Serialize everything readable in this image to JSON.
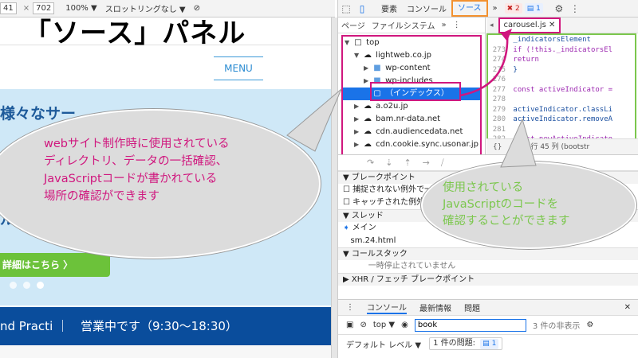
{
  "left": {
    "toolbar": {
      "width_value": "41",
      "height_value": "702",
      "zoom": "100%",
      "zoom_caret": "▼",
      "throttle": "スロットリングなし",
      "throttle_caret": "▼"
    },
    "title": "「ソース」パネル",
    "menu_label": "MENU",
    "hero_heading": "様々なサー",
    "hero_sub": "ルタン",
    "detail_button": "詳細はこちら 〉",
    "footer_text": "nd Practi ｜　営業中です（9:30〜18:30）"
  },
  "devtools": {
    "tabs": [
      "要素",
      "コンソール",
      "ソース"
    ],
    "active_tab": "ソース",
    "more_tabs": "»",
    "error_count": "2",
    "message_count": "1",
    "nav_tabs": [
      "ページ",
      "ファイルシステム"
    ],
    "tree": [
      {
        "label": "top",
        "indent": 0,
        "arrow": "▼",
        "icon": "□",
        "kind": "frame"
      },
      {
        "label": "lightweb.co.jp",
        "indent": 1,
        "arrow": "▼",
        "icon": "☁",
        "kind": "domain"
      },
      {
        "label": "wp-content",
        "indent": 2,
        "arrow": "▶",
        "icon": "■",
        "kind": "folder"
      },
      {
        "label": "wp-includes",
        "indent": 2,
        "arrow": "▶",
        "icon": "■",
        "kind": "folder"
      },
      {
        "label": "（インデックス）",
        "indent": 2,
        "arrow": "",
        "icon": "▢",
        "kind": "file",
        "selected": true
      },
      {
        "label": "a.o2u.jp",
        "indent": 1,
        "arrow": "▶",
        "icon": "☁",
        "kind": "domain"
      },
      {
        "label": "bam.nr-data.net",
        "indent": 1,
        "arrow": "▶",
        "icon": "☁",
        "kind": "domain"
      },
      {
        "label": "cdn.audiencedata.net",
        "indent": 1,
        "arrow": "▶",
        "icon": "☁",
        "kind": "domain"
      },
      {
        "label": "cdn.cookie.sync.usonar.jp",
        "indent": 1,
        "arrow": "▶",
        "icon": "☁",
        "kind": "domain"
      }
    ],
    "file_tab": "carousel.js",
    "code": [
      {
        "ln": "",
        "text": "  _indicatorsElement"
      },
      {
        "ln": "",
        "text": "  if (!this._indicatorsEl"
      },
      {
        "ln": "",
        "text": "    return"
      },
      {
        "ln": "",
        "text": "  }"
      },
      {
        "ln": "276",
        "text": ""
      },
      {
        "ln": "",
        "text": "  const activeIndicator ="
      },
      {
        "ln": "",
        "text": ""
      },
      {
        "ln": "278",
        "text": "  activeIndicator.classLi"
      },
      {
        "ln": "",
        "text": "  activeIndicator.removeA"
      },
      {
        "ln": "280",
        "text": ""
      },
      {
        "ln": "281",
        "text": "  const newActiveIndicato"
      },
      {
        "ln": "",
        "text": ""
      }
    ],
    "line_numbers_side": [
      "273",
      "274",
      "275",
      "276",
      "277",
      "278",
      "279",
      "280",
      "281",
      "282"
    ],
    "editor_status": "{}　　　　行 45 列 (bootstr",
    "debug": {
      "breakpoints_header": "ブレークポイント",
      "uncaught": "捕捉されない例外で一",
      "caught": "キャッチされた例外",
      "threads_header": "スレッド",
      "main_thread": "メイン",
      "script": "sm.24.html",
      "callstack_header": "コールスタック",
      "not_paused": "一時停止されていません",
      "xhr_header": "XHR / フェッチ ブレークポイント"
    },
    "console": {
      "tabs": [
        "コンソール",
        "最新情報",
        "問題"
      ],
      "context": "top",
      "filter_value": "book",
      "hidden_count": "3 件の非表示",
      "default_levels": "デフォルト レベル ▼",
      "issues": "1 件の問題:",
      "issues_count": "1"
    }
  },
  "callouts": {
    "left_lines": [
      "webサイト制作時に使用されている",
      "ディレクトリ、データの一括確認、",
      "JavaScriptコードが書かれている",
      "場所の確認ができます"
    ],
    "right_lines": [
      "使用されている",
      "JavaScriptのコードを",
      "確認することができます"
    ],
    "colors": {
      "magenta": "#d0177e",
      "green": "#7bc74d",
      "orange": "#f3912f"
    }
  }
}
